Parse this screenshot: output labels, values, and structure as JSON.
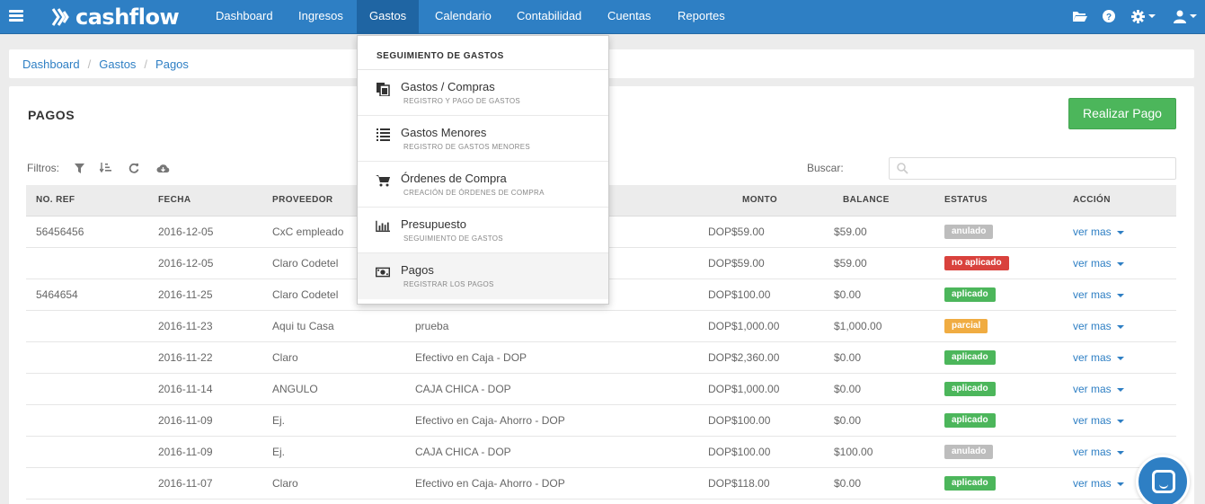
{
  "brand": {
    "name": "cashflow"
  },
  "nav": {
    "items": [
      "Dashboard",
      "Ingresos",
      "Gastos",
      "Calendario",
      "Contabilidad",
      "Cuentas",
      "Reportes"
    ],
    "active": "Gastos"
  },
  "topbar_icons": [
    "folder-open-icon",
    "help-icon",
    "gear-icon",
    "user-icon"
  ],
  "breadcrumb": [
    "Dashboard",
    "Gastos",
    "Pagos"
  ],
  "page": {
    "title": "PAGOS",
    "primary_button": "Realizar Pago",
    "filters_label": "Filtros:",
    "search_label": "Buscar:",
    "search_value": ""
  },
  "table": {
    "columns": [
      "NO. REF",
      "FECHA",
      "PROVEEDOR",
      "MONTO",
      "BALANCE",
      "ESTATUS",
      "ACCIÓN"
    ],
    "action_label": "ver mas",
    "rows": [
      {
        "ref": "56456456",
        "fecha": "2016-12-05",
        "proveedor": "CxC empleado",
        "cuenta": "",
        "monto": "DOP$59.00",
        "balance": "$59.00",
        "estatus": "anulado"
      },
      {
        "ref": "",
        "fecha": "2016-12-05",
        "proveedor": "Claro Codetel",
        "cuenta": "",
        "monto": "DOP$59.00",
        "balance": "$59.00",
        "estatus": "no aplicado"
      },
      {
        "ref": "5464654",
        "fecha": "2016-11-25",
        "proveedor": "Claro Codetel",
        "cuenta": "",
        "monto": "DOP$100.00",
        "balance": "$0.00",
        "estatus": "aplicado"
      },
      {
        "ref": "",
        "fecha": "2016-11-23",
        "proveedor": "Aqui tu Casa",
        "cuenta": "prueba",
        "monto": "DOP$1,000.00",
        "balance": "$1,000.00",
        "estatus": "parcial"
      },
      {
        "ref": "",
        "fecha": "2016-11-22",
        "proveedor": "Claro",
        "cuenta": "Efectivo en Caja - DOP",
        "monto": "DOP$2,360.00",
        "balance": "$0.00",
        "estatus": "aplicado"
      },
      {
        "ref": "",
        "fecha": "2016-11-14",
        "proveedor": "ANGULO",
        "cuenta": "CAJA CHICA - DOP",
        "monto": "DOP$1,000.00",
        "balance": "$0.00",
        "estatus": "aplicado"
      },
      {
        "ref": "",
        "fecha": "2016-11-09",
        "proveedor": "Ej.",
        "cuenta": "Efectivo en Caja- Ahorro - DOP",
        "monto": "DOP$100.00",
        "balance": "$0.00",
        "estatus": "aplicado"
      },
      {
        "ref": "",
        "fecha": "2016-11-09",
        "proveedor": "Ej.",
        "cuenta": "CAJA CHICA - DOP",
        "monto": "DOP$100.00",
        "balance": "$100.00",
        "estatus": "anulado"
      },
      {
        "ref": "",
        "fecha": "2016-11-07",
        "proveedor": "Claro",
        "cuenta": "Efectivo en Caja- Ahorro - DOP",
        "monto": "DOP$118.00",
        "balance": "$0.00",
        "estatus": "aplicado"
      }
    ]
  },
  "dropdown": {
    "header": "SEGUIMIENTO DE GASTOS",
    "items": [
      {
        "icon": "copy-icon",
        "title": "Gastos / Compras",
        "subtitle": "REGISTRO Y PAGO DE GASTOS"
      },
      {
        "icon": "list-icon",
        "title": "Gastos Menores",
        "subtitle": "REGISTRO DE GASTOS MENORES"
      },
      {
        "icon": "cart-icon",
        "title": "Órdenes de Compra",
        "subtitle": "CREACIÓN DE ÓRDENES DE COMPRA"
      },
      {
        "icon": "bar-chart-icon",
        "title": "Presupuesto",
        "subtitle": "SEGUIMIENTO DE GASTOS"
      },
      {
        "icon": "money-icon",
        "title": "Pagos",
        "subtitle": "REGISTRAR LOS PAGOS"
      }
    ]
  },
  "status_colors": {
    "anulado": "#bdbdbd",
    "no aplicado": "#d9423d",
    "aplicado": "#4cb65b",
    "parcial": "#f0ac42"
  },
  "colors": {
    "brand": "#2e7fc4",
    "success": "#4cb65b"
  }
}
